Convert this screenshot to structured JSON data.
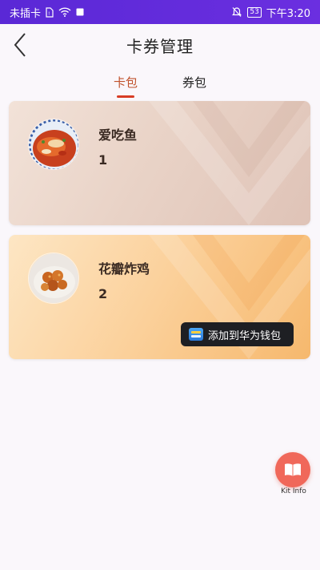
{
  "status_bar": {
    "carrier": "未插卡",
    "battery": "53",
    "time": "下午3:20"
  },
  "header": {
    "title": "卡券管理"
  },
  "tabs": [
    {
      "label": "卡包",
      "active": true
    },
    {
      "label": "券包",
      "active": false
    }
  ],
  "cards": [
    {
      "name": "爱吃鱼",
      "count": "1",
      "image": "fish-dish-photo"
    },
    {
      "name": "花瓣炸鸡",
      "count": "2",
      "image": "fried-chicken-photo",
      "wallet_button": "添加到华为钱包"
    }
  ],
  "fab": {
    "label": "Kit Info",
    "icon": "book-icon",
    "color": "#f0685a"
  },
  "colors": {
    "accent": "#d83d25",
    "status_bar": "#5a28d6"
  }
}
